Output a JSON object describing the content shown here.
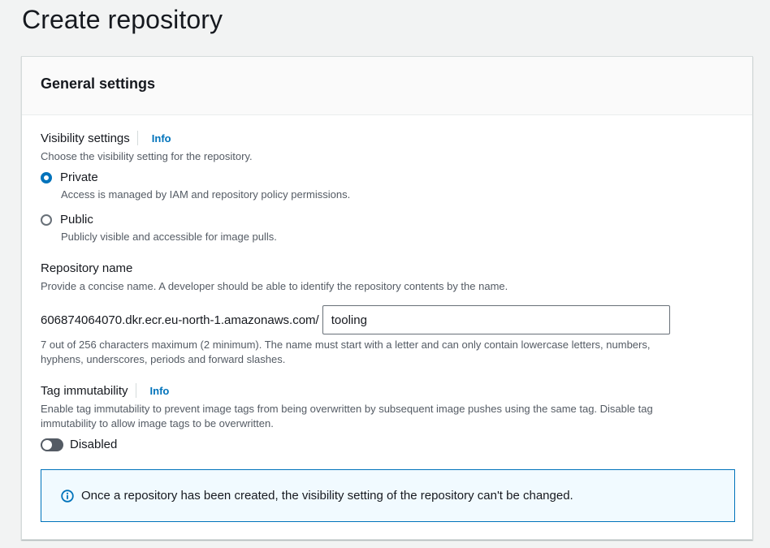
{
  "page": {
    "title": "Create repository"
  },
  "panel": {
    "title": "General settings"
  },
  "visibility": {
    "label": "Visibility settings",
    "info": "Info",
    "description": "Choose the visibility setting for the repository.",
    "selected": "Private",
    "options": [
      {
        "label": "Private",
        "description": "Access is managed by IAM and repository policy permissions.",
        "checked": true
      },
      {
        "label": "Public",
        "description": "Publicly visible and accessible for image pulls.",
        "checked": false
      }
    ]
  },
  "repository_name": {
    "label": "Repository name",
    "description": "Provide a concise name. A developer should be able to identify the repository contents by the name.",
    "uri_prefix": "606874064070.dkr.ecr.eu-north-1.amazonaws.com/",
    "value": "tooling",
    "constraint_line1": "7 out of 256 characters maximum (2 minimum). The name must start with a letter and can only contain lowercase letters, numbers,",
    "constraint_line2": "hyphens, underscores, periods and forward slashes."
  },
  "tag_immutability": {
    "label": "Tag immutability",
    "info": "Info",
    "description_line1": "Enable tag immutability to prevent image tags from being overwritten by subsequent image pushes using the same tag. Disable tag",
    "description_line2": "immutability to allow image tags to be overwritten.",
    "toggle_label": "Disabled",
    "enabled": false
  },
  "alert": {
    "icon": "info-circle-icon",
    "text": "Once a repository has been created, the visibility setting of the repository can't be changed."
  },
  "colors": {
    "accent": "#0073bb",
    "background": "#f2f3f3",
    "alert_background": "#f1faff"
  }
}
